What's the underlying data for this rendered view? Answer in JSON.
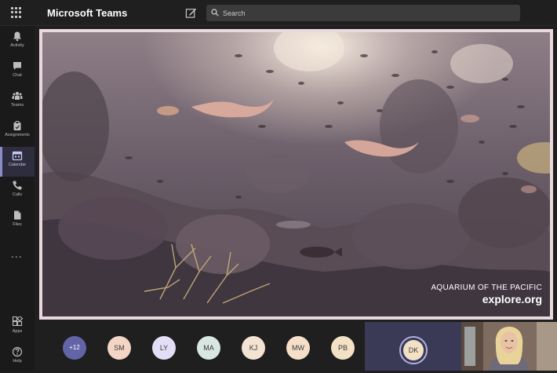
{
  "app": {
    "title": "Microsoft Teams"
  },
  "search": {
    "placeholder": "Search"
  },
  "rail": {
    "items": [
      {
        "label": "Activity",
        "icon": "bell-icon"
      },
      {
        "label": "Chat",
        "icon": "chat-icon"
      },
      {
        "label": "Teams",
        "icon": "teams-icon"
      },
      {
        "label": "Assignments",
        "icon": "assignments-icon"
      },
      {
        "label": "Calendar",
        "icon": "calendar-icon",
        "active": true
      },
      {
        "label": "Calls",
        "icon": "phone-icon"
      },
      {
        "label": "Files",
        "icon": "file-icon"
      }
    ],
    "more": "...",
    "bottom": [
      {
        "label": "Apps",
        "icon": "apps-icon"
      },
      {
        "label": "Help",
        "icon": "help-icon"
      }
    ]
  },
  "video": {
    "watermark_line1": "AQUARIUM OF THE PACIFIC",
    "watermark_line2": "explore.org"
  },
  "participants": {
    "overflow_count": "+12",
    "avatars": [
      "SM",
      "LY",
      "MA",
      "KJ",
      "MW",
      "PB"
    ],
    "active_speaker": "DK"
  },
  "colors": {
    "accent": "#6264a7",
    "background": "#1f1f1f",
    "rail_active_indicator": "#8b8cc7"
  }
}
